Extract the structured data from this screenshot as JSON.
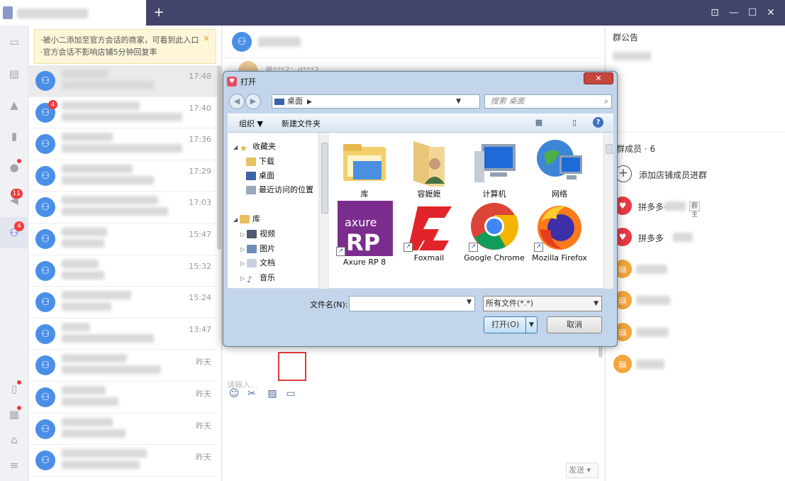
{
  "window": {
    "new_tab": "+",
    "pin": "⊡",
    "minimize": "—",
    "maximize": "☐",
    "close": "✕"
  },
  "notice": {
    "line1": "·被小二添加至官方会话的商家，可看到此入口",
    "line2": "·官方会话不影响店铺5分钟回复率",
    "close": "×"
  },
  "rail": {
    "badge_11": "11",
    "badge_4": "4"
  },
  "conversations": [
    {
      "time": "17:48",
      "badge": ""
    },
    {
      "time": "17:40",
      "badge": "4"
    },
    {
      "time": "17:36",
      "badge": ""
    },
    {
      "time": "17:29",
      "badge": ""
    },
    {
      "time": "17:03",
      "badge": ""
    },
    {
      "time": "15:47",
      "badge": ""
    },
    {
      "time": "15:32",
      "badge": ""
    },
    {
      "time": "15:24",
      "badge": ""
    },
    {
      "time": "13:47",
      "badge": ""
    },
    {
      "time": "昨天",
      "badge": ""
    },
    {
      "time": "昨天",
      "badge": ""
    },
    {
      "time": "昨天",
      "badge": ""
    },
    {
      "time": "昨天",
      "badge": ""
    }
  ],
  "chat": {
    "sender": "单***2：d***2",
    "input_placeholder": "请输入...",
    "send": "发送 ▾"
  },
  "right": {
    "announcement_title": "群公告",
    "members_title": "群成员 · 6",
    "add_member": "添加店铺成员进群",
    "members": [
      {
        "name": "拼多多·",
        "role": "群主"
      },
      {
        "name": "拼多多",
        "role": ""
      }
    ]
  },
  "dialog": {
    "title": "打开",
    "address": "桌面",
    "search_placeholder": "搜索 桌面",
    "organize": "组织 ▼",
    "new_folder": "新建文件夹",
    "nav": {
      "favorites": "收藏夹",
      "downloads": "下载",
      "desktop": "桌面",
      "recent": "最近访问的位置",
      "libraries": "库",
      "videos": "视频",
      "pictures": "图片",
      "documents": "文档",
      "music": "音乐"
    },
    "files": [
      "库",
      "容嬷嬷",
      "计算机",
      "网络",
      "Axure RP 8",
      "Foxmail",
      "Google Chrome",
      "Mozilla Firefox"
    ],
    "filename_label": "文件名(N):",
    "file_type": "所有文件(*.*)",
    "open": "打开(O)",
    "cancel": "取消"
  },
  "colors": {
    "accent": "#3b5bdb",
    "avatar_blue": "#4a8fe7",
    "badge_red": "#f03c3c",
    "highlight_red": "#e03a3a",
    "titlebar": "#42446a"
  }
}
